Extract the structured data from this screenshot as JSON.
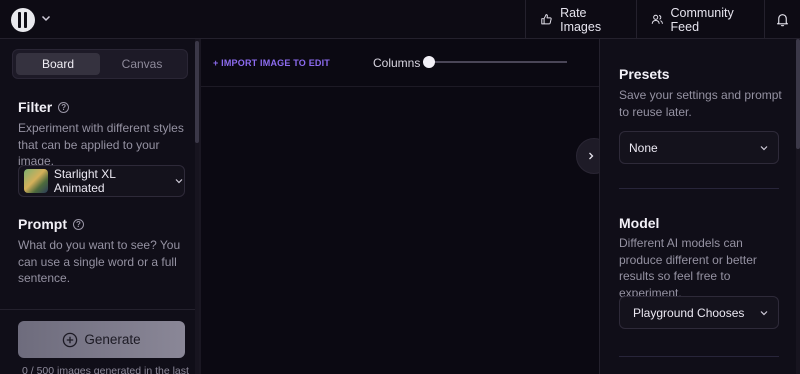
{
  "header": {
    "logo_icon": "logo-icon",
    "rate_label": "Rate Images",
    "feed_label": "Community Feed",
    "bell_icon": "bell-icon"
  },
  "left": {
    "tabs": [
      "Board",
      "Canvas"
    ],
    "active_tab": "Board",
    "filter": {
      "title": "Filter",
      "desc": "Experiment with different styles that can be applied to your image.",
      "selected": "Starlight XL Animated"
    },
    "prompt": {
      "title": "Prompt",
      "desc": "What do you want to see? You can use a single word or a full sentence."
    },
    "generate_label": "Generate",
    "generated_note": "0 / 500 images generated in the last"
  },
  "center": {
    "import_label": "+ IMPORT IMAGE TO EDIT",
    "columns_label": "Columns",
    "columns_value_fraction": 0
  },
  "right": {
    "presets": {
      "title": "Presets",
      "desc": "Save your settings and prompt to reuse later.",
      "selected": "None"
    },
    "model": {
      "title": "Model",
      "desc": "Different AI models can produce different or better results so feel free to experiment.",
      "selected": "Playground Chooses"
    }
  },
  "colors": {
    "background": "#0b0912",
    "accent": "#8d6cf0"
  }
}
